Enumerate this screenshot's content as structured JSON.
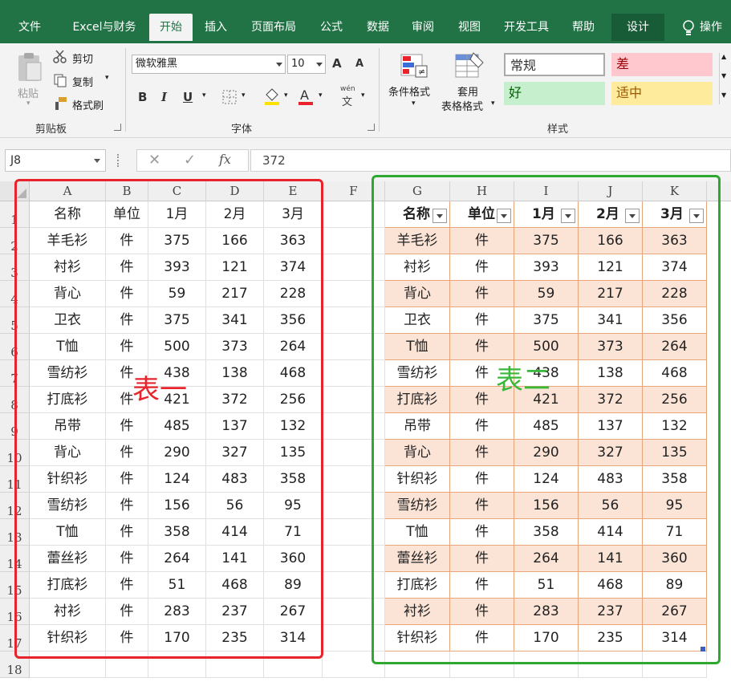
{
  "ribbon_tabs": [
    "文件",
    "Excel与财务",
    "开始",
    "插入",
    "页面布局",
    "公式",
    "数据",
    "审阅",
    "视图",
    "开发工具",
    "帮助",
    "设计",
    "操作"
  ],
  "active_tab": "开始",
  "clipboard": {
    "paste": "粘贴",
    "cut": "剪切",
    "copy": "复制",
    "painter": "格式刷",
    "label": "剪贴板"
  },
  "font": {
    "name": "微软雅黑",
    "size": "10",
    "grow": "A",
    "shrink": "A",
    "bold": "B",
    "italic": "I",
    "underline": "U",
    "label": "字体",
    "wen": "wén",
    "wen_char": "文"
  },
  "styles": {
    "cond_format": "条件格式",
    "table_format_1": "套用",
    "table_format_2": "表格格式",
    "normal": "常规",
    "bad": "差",
    "good": "好",
    "neutral": "适中",
    "label": "样式"
  },
  "formula_bar": {
    "cell_ref": "J8",
    "fx": "fx",
    "value": "372"
  },
  "columns": [
    "A",
    "B",
    "C",
    "D",
    "E",
    "F",
    "G",
    "H",
    "I",
    "J",
    "K"
  ],
  "rows": [
    "1",
    "2",
    "3",
    "4",
    "5",
    "6",
    "7",
    "8",
    "9",
    "10",
    "11",
    "12",
    "13",
    "14",
    "15",
    "16",
    "17",
    "18"
  ],
  "table_header": [
    "名称",
    "单位",
    "1月",
    "2月",
    "3月"
  ],
  "table_rows": [
    [
      "羊毛衫",
      "件",
      "375",
      "166",
      "363"
    ],
    [
      "衬衫",
      "件",
      "393",
      "121",
      "374"
    ],
    [
      "背心",
      "件",
      "59",
      "217",
      "228"
    ],
    [
      "卫衣",
      "件",
      "375",
      "341",
      "356"
    ],
    [
      "T恤",
      "件",
      "500",
      "373",
      "264"
    ],
    [
      "雪纺衫",
      "件",
      "438",
      "138",
      "468"
    ],
    [
      "打底衫",
      "件",
      "421",
      "372",
      "256"
    ],
    [
      "吊带",
      "件",
      "485",
      "137",
      "132"
    ],
    [
      "背心",
      "件",
      "290",
      "327",
      "135"
    ],
    [
      "针织衫",
      "件",
      "124",
      "483",
      "358"
    ],
    [
      "雪纺衫",
      "件",
      "156",
      "56",
      "95"
    ],
    [
      "T恤",
      "件",
      "358",
      "414",
      "71"
    ],
    [
      "蕾丝衫",
      "件",
      "264",
      "141",
      "360"
    ],
    [
      "打底衫",
      "件",
      "51",
      "468",
      "89"
    ],
    [
      "衬衫",
      "件",
      "283",
      "237",
      "267"
    ],
    [
      "针织衫",
      "件",
      "170",
      "235",
      "314"
    ]
  ],
  "annotations": {
    "table1": "表一",
    "table2": "表二"
  },
  "colors": {
    "excel_green": "#217346",
    "band_fill": "#fbe4d6",
    "border_orange": "#e8a47a",
    "red_outline": "#e8232b",
    "green_outline": "#2ea82e"
  }
}
